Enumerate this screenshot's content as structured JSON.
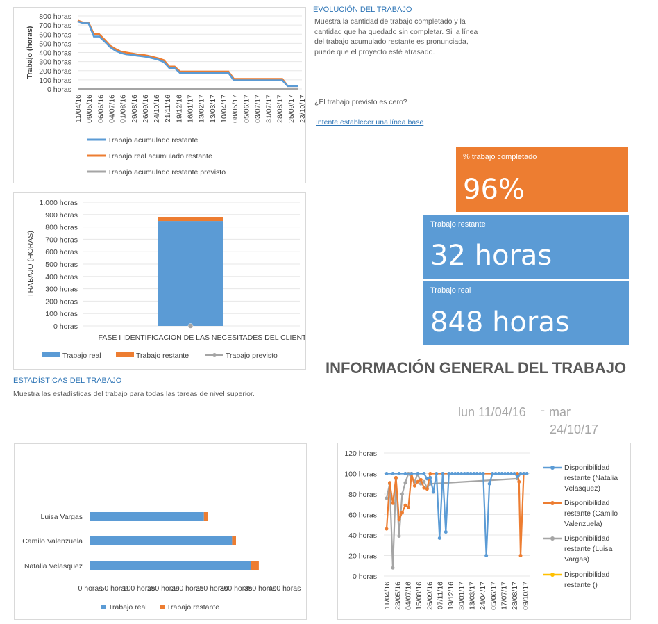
{
  "colors": {
    "blue": "#5b9bd5",
    "orange": "#ed7d31",
    "gray": "#a5a5a5",
    "yellow": "#ffc000",
    "title_blue": "#2e75b6",
    "title_dark": "#595959"
  },
  "evolution": {
    "title": "EVOLUCIÓN DEL TRABAJO",
    "description": "Muestra la cantidad de trabajo completado y la cantidad que ha quedado sin completar. Si la línea del trabajo acumulado restante es pronunciada, puede que el proyecto esté atrasado.",
    "question": "¿El trabajo previsto es cero?",
    "link": "Intente establecer una línea base"
  },
  "kpis": {
    "completed": {
      "label": "% trabajo completado",
      "value": "96%",
      "color": "#ed7d31"
    },
    "remaining": {
      "label": "Trabajo restante",
      "value": "32 horas",
      "color": "#5b9bd5"
    },
    "actual": {
      "label": "Trabajo real",
      "value": "848 horas",
      "color": "#5b9bd5"
    }
  },
  "general": {
    "title": "INFORMACIÓN GENERAL DEL TRABAJO",
    "date_start": "lun 11/04/16",
    "date_sep": "-",
    "date_end_1": "mar",
    "date_end_2": "24/10/17"
  },
  "stats": {
    "title": "ESTADÍSTICAS DEL TRABAJO",
    "description": "Muestra las estadísticas del trabajo para todas las tareas de nivel superior."
  },
  "chart_data": [
    {
      "type": "line",
      "ylabel": "Trabajo (horas)",
      "ylim": [
        0,
        800
      ],
      "y_ticks": [
        "0 horas",
        "100 horas",
        "200 horas",
        "300 horas",
        "400 horas",
        "500 horas",
        "600 horas",
        "700 horas",
        "800 horas"
      ],
      "x_ticks": [
        "11/04/16",
        "09/05/16",
        "06/06/16",
        "04/07/16",
        "01/08/16",
        "29/08/16",
        "26/09/16",
        "24/10/16",
        "21/11/16",
        "19/12/16",
        "16/01/17",
        "13/02/17",
        "13/03/17",
        "10/04/17",
        "08/05/17",
        "05/06/17",
        "03/07/17",
        "31/07/17",
        "28/08/17",
        "25/09/17",
        "23/10/17"
      ],
      "legend": [
        "Trabajo acumulado restante",
        "Trabajo real acumulado restante",
        "Trabajo acumulado restante previsto"
      ],
      "series": [
        {
          "name": "Trabajo acumulado restante",
          "values": [
            740,
            722,
            720,
            575,
            575,
            520,
            460,
            420,
            395,
            380,
            375,
            365,
            358,
            350,
            335,
            320,
            295,
            230,
            230,
            175,
            175,
            175,
            175,
            175,
            175,
            175,
            175,
            175,
            175,
            95,
            95,
            95,
            95,
            95,
            95,
            95,
            95,
            95,
            95,
            32,
            32,
            32
          ]
        },
        {
          "name": "Trabajo real acumulado restante",
          "values": [
            750,
            728,
            728,
            600,
            600,
            540,
            475,
            440,
            410,
            400,
            390,
            380,
            375,
            365,
            350,
            335,
            315,
            245,
            245,
            190,
            190,
            190,
            190,
            190,
            190,
            190,
            190,
            190,
            190,
            110,
            110,
            110,
            110,
            110,
            110,
            110,
            110,
            110,
            110,
            32,
            32,
            32
          ]
        },
        {
          "name": "Trabajo acumulado restante previsto",
          "values": [
            0,
            0,
            0,
            0,
            0,
            0,
            0,
            0,
            0,
            0,
            0,
            0,
            0,
            0,
            0,
            0,
            0,
            0,
            0,
            0,
            0,
            0,
            0,
            0,
            0,
            0,
            0,
            0,
            0,
            0,
            0,
            0,
            0,
            0,
            0,
            0,
            0,
            0,
            0,
            0,
            0,
            0
          ]
        }
      ]
    },
    {
      "type": "bar",
      "ylabel": "TRABAJO (HORAS)",
      "ylim": [
        0,
        1000
      ],
      "y_ticks": [
        "0 horas",
        "100 horas",
        "200 horas",
        "300 horas",
        "400 horas",
        "500 horas",
        "600 horas",
        "700 horas",
        "800 horas",
        "900 horas",
        "1.000 horas"
      ],
      "categories": [
        "FASE I IDENTIFICACION DE LAS NECESITADES DEL CLIENTE"
      ],
      "series": [
        {
          "name": "Trabajo real",
          "values": [
            848
          ]
        },
        {
          "name": "Trabajo restante",
          "values": [
            32
          ]
        },
        {
          "name": "Trabajo previsto",
          "values": [
            0
          ]
        }
      ]
    },
    {
      "type": "bar",
      "orientation": "horizontal",
      "xlim": [
        0,
        400
      ],
      "x_ticks": [
        "0 horas",
        "50 horas",
        "100 horas",
        "150 horas",
        "200 horas",
        "250 horas",
        "300 horas",
        "350 horas",
        "400 horas"
      ],
      "categories": [
        "Luisa Vargas",
        "Camilo Valenzuela",
        "Natalia Velasquez"
      ],
      "series": [
        {
          "name": "Trabajo real",
          "values": [
            234,
            292,
            330
          ]
        },
        {
          "name": "Trabajo restante",
          "values": [
            8,
            8,
            17
          ]
        }
      ]
    },
    {
      "type": "line",
      "ylim": [
        0,
        120
      ],
      "y_ticks": [
        "0 horas",
        "20 horas",
        "40 horas",
        "60 horas",
        "80 horas",
        "100 horas",
        "120 horas"
      ],
      "x_ticks": [
        "11/04/16",
        "23/05/16",
        "04/07/16",
        "15/08/16",
        "26/09/16",
        "07/11/16",
        "19/12/16",
        "30/01/17",
        "13/03/17",
        "24/04/17",
        "05/06/17",
        "17/07/17",
        "28/08/17",
        "09/10/17"
      ],
      "series": [
        {
          "name": "Disponibilidad restante (Natalia Velasquez)",
          "values": [
            100,
            100,
            100,
            100,
            100,
            100,
            100,
            100,
            100,
            100,
            100,
            100,
            100,
            100,
            100,
            100,
            100,
            100,
            100,
            100,
            100,
            100,
            100,
            100,
            100,
            100,
            100,
            100,
            100,
            100,
            100,
            100,
            100,
            100,
            100,
            100,
            100,
            100,
            100,
            100,
            100,
            100,
            100,
            100,
            100,
            100,
            100,
            100,
            100,
            100,
            100,
            100,
            100,
            100,
            100,
            100,
            100,
            100,
            100,
            100,
            100,
            100,
            100,
            100,
            100,
            100,
            100,
            100,
            100,
            100,
            100,
            100,
            100,
            100,
            100,
            100,
            100,
            100,
            100,
            100,
            100,
            100,
            100,
            100,
            100,
            100,
            100,
            100,
            100,
            100,
            100,
            100,
            100,
            100,
            100,
            100,
            100,
            100,
            100,
            100
          ],
          "points": [
            [
              0,
              100
            ],
            [
              4,
              100
            ],
            [
              8,
              100
            ],
            [
              12,
              100
            ],
            [
              16,
              100
            ],
            [
              20,
              100
            ],
            [
              24,
              100
            ],
            [
              26,
              95
            ],
            [
              28,
              96
            ],
            [
              30,
              82
            ],
            [
              32,
              100
            ],
            [
              34,
              37
            ],
            [
              36,
              100
            ],
            [
              38,
              43
            ],
            [
              40,
              100
            ],
            [
              42,
              100
            ],
            [
              44,
              100
            ],
            [
              46,
              100
            ],
            [
              48,
              100
            ],
            [
              50,
              100
            ],
            [
              52,
              100
            ],
            [
              54,
              100
            ],
            [
              56,
              100
            ],
            [
              58,
              100
            ],
            [
              60,
              100
            ],
            [
              62,
              100
            ],
            [
              64,
              20
            ],
            [
              66,
              90
            ],
            [
              68,
              100
            ],
            [
              70,
              100
            ],
            [
              72,
              100
            ],
            [
              74,
              100
            ],
            [
              76,
              100
            ],
            [
              78,
              100
            ],
            [
              80,
              100
            ],
            [
              82,
              100
            ],
            [
              84,
              97
            ],
            [
              86,
              100
            ],
            [
              88,
              100
            ],
            [
              90,
              100
            ]
          ]
        },
        {
          "name": "Disponibilidad restante (Camilo Valenzuela)",
          "points": [
            [
              0,
              46
            ],
            [
              2,
              91
            ],
            [
              4,
              71
            ],
            [
              6,
              96
            ],
            [
              8,
              55
            ],
            [
              10,
              62
            ],
            [
              12,
              69
            ],
            [
              14,
              67
            ],
            [
              16,
              100
            ],
            [
              18,
              88
            ],
            [
              20,
              92
            ],
            [
              22,
              94
            ],
            [
              24,
              86
            ],
            [
              26,
              85
            ],
            [
              28,
              100
            ],
            [
              84,
              100
            ],
            [
              85,
              92
            ],
            [
              86,
              20
            ],
            [
              88,
              100
            ]
          ]
        },
        {
          "name": "Disponibilidad restante (Luisa Vargas)",
          "points": [
            [
              0,
              76
            ],
            [
              2,
              90
            ],
            [
              4,
              8
            ],
            [
              6,
              95
            ],
            [
              8,
              39
            ],
            [
              10,
              80
            ],
            [
              12,
              91
            ],
            [
              14,
              100
            ],
            [
              16,
              96
            ],
            [
              18,
              92
            ],
            [
              20,
              100
            ],
            [
              22,
              90
            ],
            [
              24,
              92
            ],
            [
              26,
              86
            ],
            [
              28,
              90
            ],
            [
              84,
              95
            ],
            [
              86,
              100
            ]
          ]
        },
        {
          "name": "Disponibilidad restante ()",
          "points": []
        }
      ]
    }
  ]
}
